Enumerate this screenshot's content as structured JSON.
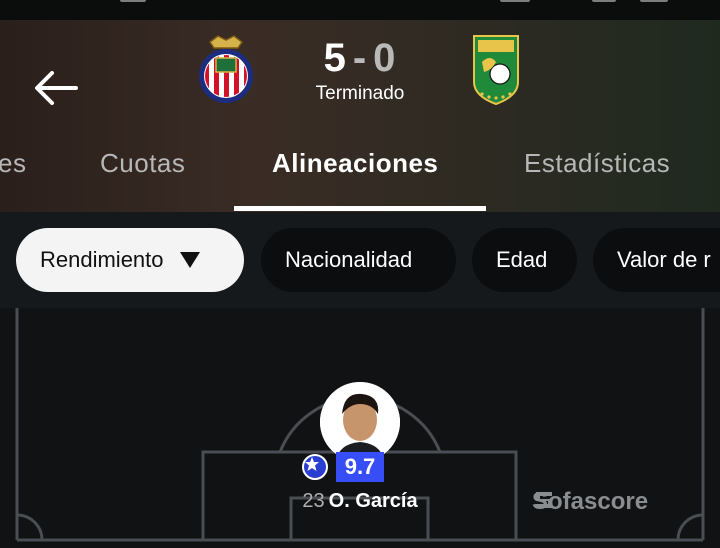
{
  "match": {
    "home_score": "5",
    "separator": "-",
    "away_score": "0",
    "status": "Terminado"
  },
  "tabs": [
    {
      "label": "es"
    },
    {
      "label": "Cuotas"
    },
    {
      "label": "Alineaciones"
    },
    {
      "label": "Estadísticas"
    }
  ],
  "active_tab": "Alineaciones",
  "filters": [
    {
      "label": "Rendimiento"
    },
    {
      "label": "Nacionalidad"
    },
    {
      "label": "Edad"
    },
    {
      "label": "Valor de r"
    }
  ],
  "player": {
    "number": "23",
    "name": "O. García",
    "rating": "9.7"
  },
  "watermark": "Sofascore",
  "colors": {
    "rating_badge": "#374df5",
    "header_bg": "#3a2c25",
    "filters_bg": "#15191b",
    "pitch_bg": "#101213"
  },
  "icons": {
    "back": "arrow-left-icon",
    "rating": "star-icon",
    "dropdown": "caret-down-icon",
    "home_logo": "chivas-crest-icon",
    "away_logo": "leon-crest-icon"
  }
}
